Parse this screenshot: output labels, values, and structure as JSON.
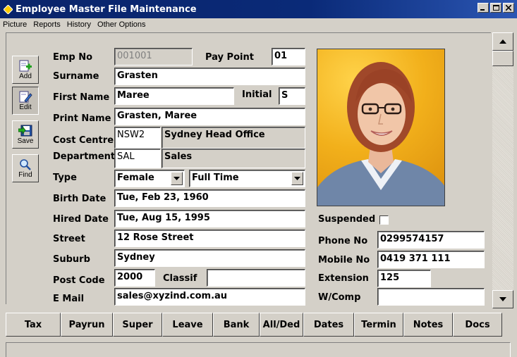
{
  "window": {
    "title": "Employee Master File Maintenance",
    "controls": {
      "minimize": "_",
      "maximize": "□",
      "close": "✕"
    }
  },
  "menu": {
    "items": [
      "Picture",
      "Reports",
      "History",
      "Other Options"
    ]
  },
  "toolbar": {
    "add_label": "Add",
    "edit_label": "Edit",
    "save_label": "Save",
    "find_label": "Find"
  },
  "form": {
    "emp_no": {
      "label": "Emp No",
      "value": "001001"
    },
    "pay_point": {
      "label": "Pay Point",
      "value": "01"
    },
    "surname": {
      "label": "Surname",
      "value": "Grasten"
    },
    "first_name": {
      "label": "First Name",
      "value": "Maree"
    },
    "initial": {
      "label": "Initial",
      "value": "S"
    },
    "print_name": {
      "label": "Print Name",
      "value": "Grasten, Maree"
    },
    "cost_centre": {
      "label": "Cost Centre",
      "code": "NSW2",
      "name": "Sydney Head Office"
    },
    "department": {
      "label": "Department",
      "code": "SAL",
      "name": "Sales"
    },
    "type": {
      "label": "Type",
      "gender": "Female",
      "employment": "Full Time"
    },
    "birth_date": {
      "label": "Birth Date",
      "value": "Tue, Feb 23, 1960"
    },
    "hired_date": {
      "label": "Hired Date",
      "value": "Tue, Aug 15, 1995"
    },
    "street": {
      "label": "Street",
      "value": "12 Rose Street"
    },
    "suburb": {
      "label": "Suburb",
      "value": "Sydney"
    },
    "post_code": {
      "label": "Post Code",
      "value": "2000"
    },
    "classif": {
      "label": "Classif",
      "value": ""
    },
    "email": {
      "label": "E Mail",
      "value": "sales@xyzind.com.au"
    },
    "suspended": {
      "label": "Suspended",
      "checked": false
    },
    "phone_no": {
      "label": "Phone No",
      "value": "0299574157"
    },
    "mobile_no": {
      "label": "Mobile No",
      "value": "0419 371 111"
    },
    "extension": {
      "label": "Extension",
      "value": "125"
    },
    "wcomp": {
      "label": "W/Comp",
      "value": ""
    }
  },
  "tabs": [
    "Tax",
    "Payrun",
    "Super",
    "Leave",
    "Bank",
    "All/Ded",
    "Dates",
    "Termin",
    "Notes",
    "Docs"
  ],
  "colors": {
    "title_bar": "#0a246a",
    "window_bg": "#d4d0c8",
    "photo_bg": "#f2b01b"
  }
}
